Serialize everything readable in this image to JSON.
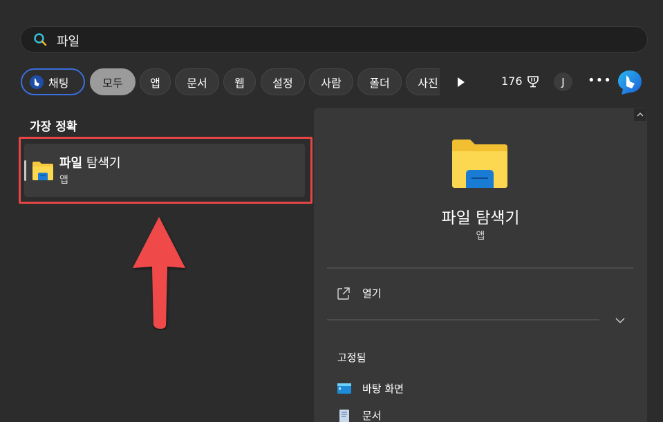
{
  "search": {
    "icon": "search-icon",
    "query": "파일"
  },
  "filters": {
    "chat_label": "채팅",
    "items": [
      {
        "label": "모두",
        "active": true
      },
      {
        "label": "앱"
      },
      {
        "label": "문서"
      },
      {
        "label": "웹"
      },
      {
        "label": "설정"
      },
      {
        "label": "사람"
      },
      {
        "label": "폴더"
      },
      {
        "label": "사진"
      }
    ],
    "points": "176",
    "avatar_initial": "J",
    "more": "•••"
  },
  "best_match": {
    "heading": "가장 정확",
    "result": {
      "name_bold": "파일",
      "name_rest": " 탐색기",
      "type": "앱",
      "icon": "file-explorer-icon"
    }
  },
  "preview": {
    "title": "파일 탐색기",
    "subtitle": "앱",
    "open_label": "열기",
    "pinned_heading": "고정됨",
    "pinned_items": [
      {
        "label": "바탕 화면",
        "icon": "desktop-icon"
      },
      {
        "label": "문서",
        "icon": "document-icon"
      }
    ]
  },
  "colors": {
    "annotation_red": "#e64545",
    "chat_border": "#3a6fe0",
    "folder_yellow": "#f7c93e",
    "folder_blue": "#1a7bd4"
  }
}
